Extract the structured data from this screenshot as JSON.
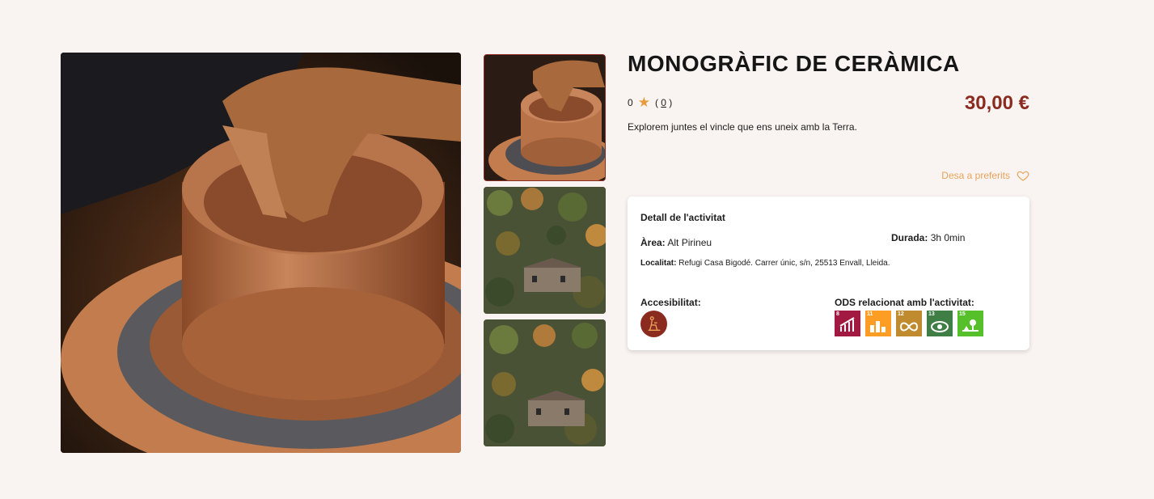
{
  "product": {
    "title": "MONOGRÀFIC DE CERÀMICA",
    "rating_value": "0",
    "rating_count": "0",
    "price": "30,00 €",
    "description": "Explorem juntes el vincle que ens uneix amb la Terra.",
    "favorite_label": "Desa a preferits"
  },
  "detail": {
    "title": "Detall de l'activitat",
    "area_label": "Àrea:",
    "area_value": "Alt Pirineu",
    "duration_label": "Durada:",
    "duration_value": "3h 0min",
    "locality_label": "Localitat:",
    "locality_value": "Refugi Casa Bigodé. Carrer únic, s/n, 25513 Envall, Lleida.",
    "accessibility_label": "Accesibilitat:",
    "ods_label": "ODS relacionat amb l'activitat:",
    "ods": [
      {
        "number": "8",
        "color": "#a21942"
      },
      {
        "number": "11",
        "color": "#fd9d24"
      },
      {
        "number": "12",
        "color": "#bf8b2e"
      },
      {
        "number": "13",
        "color": "#3f7e44"
      },
      {
        "number": "15",
        "color": "#56c02b"
      }
    ]
  },
  "colors": {
    "accent": "#8b2a1f",
    "favorite": "#e8a35a",
    "star": "#e89b3c",
    "background": "#f9f4f1"
  }
}
